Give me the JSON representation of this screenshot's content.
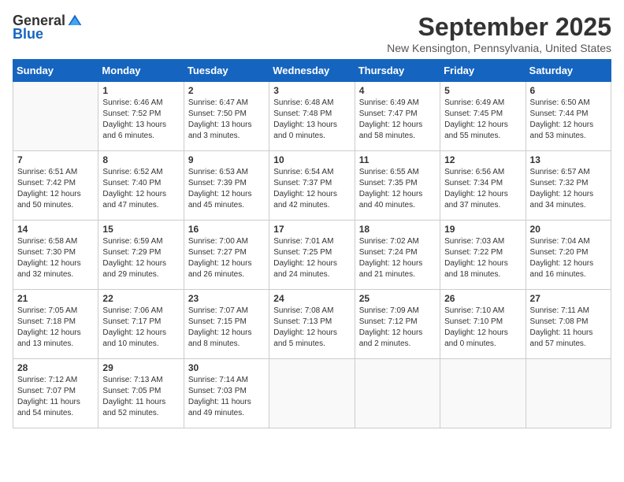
{
  "logo": {
    "general": "General",
    "blue": "Blue"
  },
  "title": "September 2025",
  "location": "New Kensington, Pennsylvania, United States",
  "days_of_week": [
    "Sunday",
    "Monday",
    "Tuesday",
    "Wednesday",
    "Thursday",
    "Friday",
    "Saturday"
  ],
  "weeks": [
    [
      {
        "day": "",
        "sunrise": "",
        "sunset": "",
        "daylight": ""
      },
      {
        "day": "1",
        "sunrise": "Sunrise: 6:46 AM",
        "sunset": "Sunset: 7:52 PM",
        "daylight": "Daylight: 13 hours and 6 minutes."
      },
      {
        "day": "2",
        "sunrise": "Sunrise: 6:47 AM",
        "sunset": "Sunset: 7:50 PM",
        "daylight": "Daylight: 13 hours and 3 minutes."
      },
      {
        "day": "3",
        "sunrise": "Sunrise: 6:48 AM",
        "sunset": "Sunset: 7:48 PM",
        "daylight": "Daylight: 13 hours and 0 minutes."
      },
      {
        "day": "4",
        "sunrise": "Sunrise: 6:49 AM",
        "sunset": "Sunset: 7:47 PM",
        "daylight": "Daylight: 12 hours and 58 minutes."
      },
      {
        "day": "5",
        "sunrise": "Sunrise: 6:49 AM",
        "sunset": "Sunset: 7:45 PM",
        "daylight": "Daylight: 12 hours and 55 minutes."
      },
      {
        "day": "6",
        "sunrise": "Sunrise: 6:50 AM",
        "sunset": "Sunset: 7:44 PM",
        "daylight": "Daylight: 12 hours and 53 minutes."
      }
    ],
    [
      {
        "day": "7",
        "sunrise": "Sunrise: 6:51 AM",
        "sunset": "Sunset: 7:42 PM",
        "daylight": "Daylight: 12 hours and 50 minutes."
      },
      {
        "day": "8",
        "sunrise": "Sunrise: 6:52 AM",
        "sunset": "Sunset: 7:40 PM",
        "daylight": "Daylight: 12 hours and 47 minutes."
      },
      {
        "day": "9",
        "sunrise": "Sunrise: 6:53 AM",
        "sunset": "Sunset: 7:39 PM",
        "daylight": "Daylight: 12 hours and 45 minutes."
      },
      {
        "day": "10",
        "sunrise": "Sunrise: 6:54 AM",
        "sunset": "Sunset: 7:37 PM",
        "daylight": "Daylight: 12 hours and 42 minutes."
      },
      {
        "day": "11",
        "sunrise": "Sunrise: 6:55 AM",
        "sunset": "Sunset: 7:35 PM",
        "daylight": "Daylight: 12 hours and 40 minutes."
      },
      {
        "day": "12",
        "sunrise": "Sunrise: 6:56 AM",
        "sunset": "Sunset: 7:34 PM",
        "daylight": "Daylight: 12 hours and 37 minutes."
      },
      {
        "day": "13",
        "sunrise": "Sunrise: 6:57 AM",
        "sunset": "Sunset: 7:32 PM",
        "daylight": "Daylight: 12 hours and 34 minutes."
      }
    ],
    [
      {
        "day": "14",
        "sunrise": "Sunrise: 6:58 AM",
        "sunset": "Sunset: 7:30 PM",
        "daylight": "Daylight: 12 hours and 32 minutes."
      },
      {
        "day": "15",
        "sunrise": "Sunrise: 6:59 AM",
        "sunset": "Sunset: 7:29 PM",
        "daylight": "Daylight: 12 hours and 29 minutes."
      },
      {
        "day": "16",
        "sunrise": "Sunrise: 7:00 AM",
        "sunset": "Sunset: 7:27 PM",
        "daylight": "Daylight: 12 hours and 26 minutes."
      },
      {
        "day": "17",
        "sunrise": "Sunrise: 7:01 AM",
        "sunset": "Sunset: 7:25 PM",
        "daylight": "Daylight: 12 hours and 24 minutes."
      },
      {
        "day": "18",
        "sunrise": "Sunrise: 7:02 AM",
        "sunset": "Sunset: 7:24 PM",
        "daylight": "Daylight: 12 hours and 21 minutes."
      },
      {
        "day": "19",
        "sunrise": "Sunrise: 7:03 AM",
        "sunset": "Sunset: 7:22 PM",
        "daylight": "Daylight: 12 hours and 18 minutes."
      },
      {
        "day": "20",
        "sunrise": "Sunrise: 7:04 AM",
        "sunset": "Sunset: 7:20 PM",
        "daylight": "Daylight: 12 hours and 16 minutes."
      }
    ],
    [
      {
        "day": "21",
        "sunrise": "Sunrise: 7:05 AM",
        "sunset": "Sunset: 7:18 PM",
        "daylight": "Daylight: 12 hours and 13 minutes."
      },
      {
        "day": "22",
        "sunrise": "Sunrise: 7:06 AM",
        "sunset": "Sunset: 7:17 PM",
        "daylight": "Daylight: 12 hours and 10 minutes."
      },
      {
        "day": "23",
        "sunrise": "Sunrise: 7:07 AM",
        "sunset": "Sunset: 7:15 PM",
        "daylight": "Daylight: 12 hours and 8 minutes."
      },
      {
        "day": "24",
        "sunrise": "Sunrise: 7:08 AM",
        "sunset": "Sunset: 7:13 PM",
        "daylight": "Daylight: 12 hours and 5 minutes."
      },
      {
        "day": "25",
        "sunrise": "Sunrise: 7:09 AM",
        "sunset": "Sunset: 7:12 PM",
        "daylight": "Daylight: 12 hours and 2 minutes."
      },
      {
        "day": "26",
        "sunrise": "Sunrise: 7:10 AM",
        "sunset": "Sunset: 7:10 PM",
        "daylight": "Daylight: 12 hours and 0 minutes."
      },
      {
        "day": "27",
        "sunrise": "Sunrise: 7:11 AM",
        "sunset": "Sunset: 7:08 PM",
        "daylight": "Daylight: 11 hours and 57 minutes."
      }
    ],
    [
      {
        "day": "28",
        "sunrise": "Sunrise: 7:12 AM",
        "sunset": "Sunset: 7:07 PM",
        "daylight": "Daylight: 11 hours and 54 minutes."
      },
      {
        "day": "29",
        "sunrise": "Sunrise: 7:13 AM",
        "sunset": "Sunset: 7:05 PM",
        "daylight": "Daylight: 11 hours and 52 minutes."
      },
      {
        "day": "30",
        "sunrise": "Sunrise: 7:14 AM",
        "sunset": "Sunset: 7:03 PM",
        "daylight": "Daylight: 11 hours and 49 minutes."
      },
      {
        "day": "",
        "sunrise": "",
        "sunset": "",
        "daylight": ""
      },
      {
        "day": "",
        "sunrise": "",
        "sunset": "",
        "daylight": ""
      },
      {
        "day": "",
        "sunrise": "",
        "sunset": "",
        "daylight": ""
      },
      {
        "day": "",
        "sunrise": "",
        "sunset": "",
        "daylight": ""
      }
    ]
  ]
}
